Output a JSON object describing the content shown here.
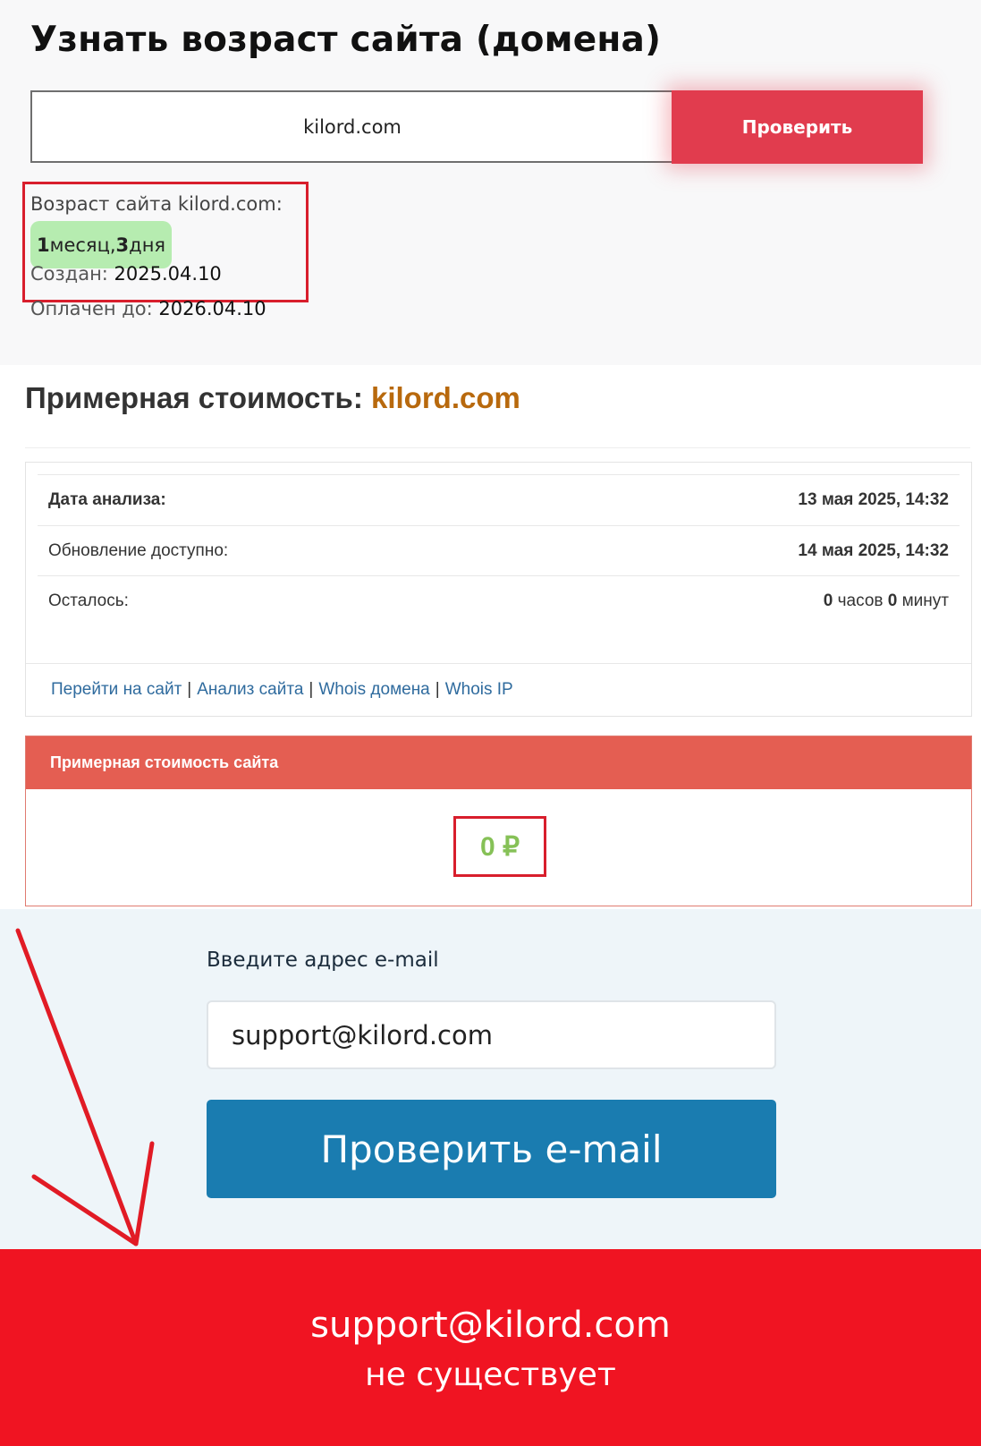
{
  "age_checker": {
    "title": "Узнать возраст сайта (домена)",
    "input_value": "kilord.com",
    "button_label": "Проверить",
    "age_label": "Возраст сайта kilord.com:",
    "age_num1": "1",
    "age_word1": " месяц, ",
    "age_num2": "3",
    "age_word2": " дня",
    "created_label": "Создан: ",
    "created_value": "2025.04.10",
    "paid_label": "Оплачен до: ",
    "paid_value": "2026.04.10"
  },
  "cost": {
    "title_prefix": "Примерная стоимость: ",
    "title_domain": "kilord.com",
    "analysis_date_label": "Дата анализа:",
    "analysis_date_value": "13 мая 2025, 14:32",
    "update_label": "Обновление доступно:",
    "update_value": "14 мая 2025, 14:32",
    "remaining_label": "Осталось:",
    "remaining_hours": "0",
    "remaining_hours_unit": " часов ",
    "remaining_minutes": "0",
    "remaining_minutes_unit": " минут",
    "links": {
      "goto_site": "Перейти на сайт",
      "site_analysis": "Анализ сайта",
      "whois_domain": "Whois домена",
      "whois_ip": "Whois IP",
      "separator": "|"
    },
    "panel_header": "Примерная стоимость сайта",
    "price": "0 ₽"
  },
  "email_check": {
    "label": "Введите адрес e-mail",
    "input_value": "support@kilord.com",
    "button_label": "Проверить e-mail"
  },
  "result": {
    "email": "support@kilord.com",
    "status": "не существует"
  },
  "colors": {
    "check_button": "#e13c4e",
    "age_badge": "#b6ecb0",
    "domain_accent": "#b8690d",
    "cost_header": "#e45e52",
    "price": "#86c157",
    "email_button": "#1a7cb0",
    "result_banner": "#f01422",
    "highlight_box": "#d81e2c"
  }
}
